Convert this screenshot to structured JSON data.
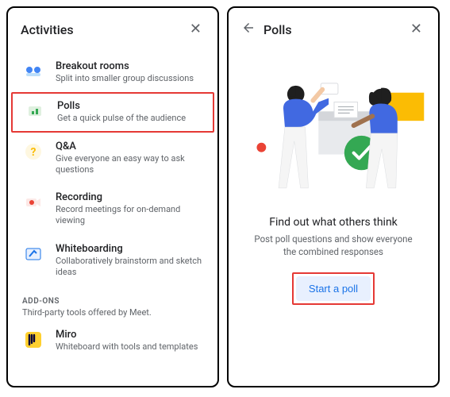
{
  "left": {
    "title": "Activities",
    "items": [
      {
        "title": "Breakout rooms",
        "sub": "Split into smaller group discussions"
      },
      {
        "title": "Polls",
        "sub": "Get a quick pulse of the audience"
      },
      {
        "title": "Q&A",
        "sub": "Give everyone an easy way to ask questions"
      },
      {
        "title": "Recording",
        "sub": "Record meetings for on-demand viewing"
      },
      {
        "title": "Whiteboarding",
        "sub": "Collaboratively brainstorm and sketch ideas"
      }
    ],
    "addons_label": "ADD-ONS",
    "addons_sub": "Third-party tools offered by Meet.",
    "addons": [
      {
        "title": "Miro",
        "sub": "Whiteboard with tools and templates"
      }
    ]
  },
  "right": {
    "title": "Polls",
    "promo_title": "Find out what others think",
    "promo_sub": "Post poll questions and show everyone the combined responses",
    "cta": "Start a poll"
  },
  "colors": {
    "highlight_border": "#e53935",
    "cta_bg": "#e8f0fe",
    "cta_text": "#1a73e8",
    "check_green": "#34a853",
    "blue_shirt": "#4169e1",
    "yellow": "#fbbc04"
  }
}
